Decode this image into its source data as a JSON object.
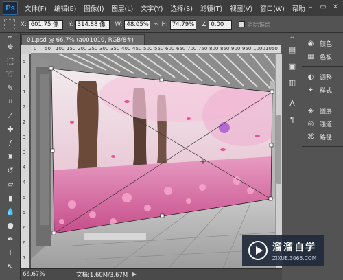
{
  "app": {
    "logo": "Ps"
  },
  "menu": [
    "文件(F)",
    "编辑(E)",
    "图像(I)",
    "图层(L)",
    "文字(Y)",
    "选择(S)",
    "滤镜(T)",
    "视图(V)",
    "窗口(W)",
    "帮助"
  ],
  "window_controls": {
    "minimize": "–",
    "restore": "▭",
    "close": "✕"
  },
  "options": {
    "x_label": "X:",
    "x_value": "601.75 像",
    "y_label": "Y:",
    "y_value": "314.88 像",
    "w_label": "W:",
    "w_value": "48.05%",
    "h_label": "H:",
    "h_value": "74.79%",
    "angle_value": "0.00",
    "antialias_label": "消除锯齿"
  },
  "document": {
    "tab_title": "01.psd @ 66.7% (a001010, RGB/8#) *",
    "close_symbol": "×"
  },
  "ruler_top_ticks": [
    "0",
    "50",
    "100",
    "150",
    "200",
    "250",
    "300",
    "350",
    "400",
    "450",
    "500",
    "550",
    "600",
    "650",
    "700",
    "750",
    "800",
    "850",
    "900",
    "950",
    "1000",
    "1050"
  ],
  "ruler_left_ticks": [
    "5",
    "1",
    "1",
    "2",
    "2",
    "3",
    "3",
    "4",
    "4",
    "5",
    "5",
    "6",
    "6",
    "7"
  ],
  "status": {
    "zoom": "66.67%",
    "doc_info": "文档:1.60M/3.67M",
    "arrow": "▶"
  },
  "panels": [
    {
      "group": 1,
      "items": [
        {
          "icon": "palette-icon",
          "glyph": "◉",
          "label": "颜色"
        },
        {
          "icon": "swatches-icon",
          "glyph": "▦",
          "label": "色板"
        }
      ]
    },
    {
      "group": 2,
      "items": [
        {
          "icon": "adjustments-icon",
          "glyph": "◐",
          "label": "调整"
        },
        {
          "icon": "styles-icon",
          "glyph": "✦",
          "label": "样式"
        }
      ]
    },
    {
      "group": 3,
      "items": [
        {
          "icon": "layers-icon",
          "glyph": "◈",
          "label": "图层"
        },
        {
          "icon": "channels-icon",
          "glyph": "◎",
          "label": "通道"
        },
        {
          "icon": "paths-icon",
          "glyph": "⌘",
          "label": "路径"
        }
      ]
    }
  ],
  "watermark": {
    "title": "溜溜自学",
    "url": "ZIXUE.3066.COM"
  },
  "colors": {
    "accent": "#35a0e8",
    "blossom": "#e27fb2",
    "ui_dark": "#3c3c3c",
    "ui_mid": "#535353"
  }
}
